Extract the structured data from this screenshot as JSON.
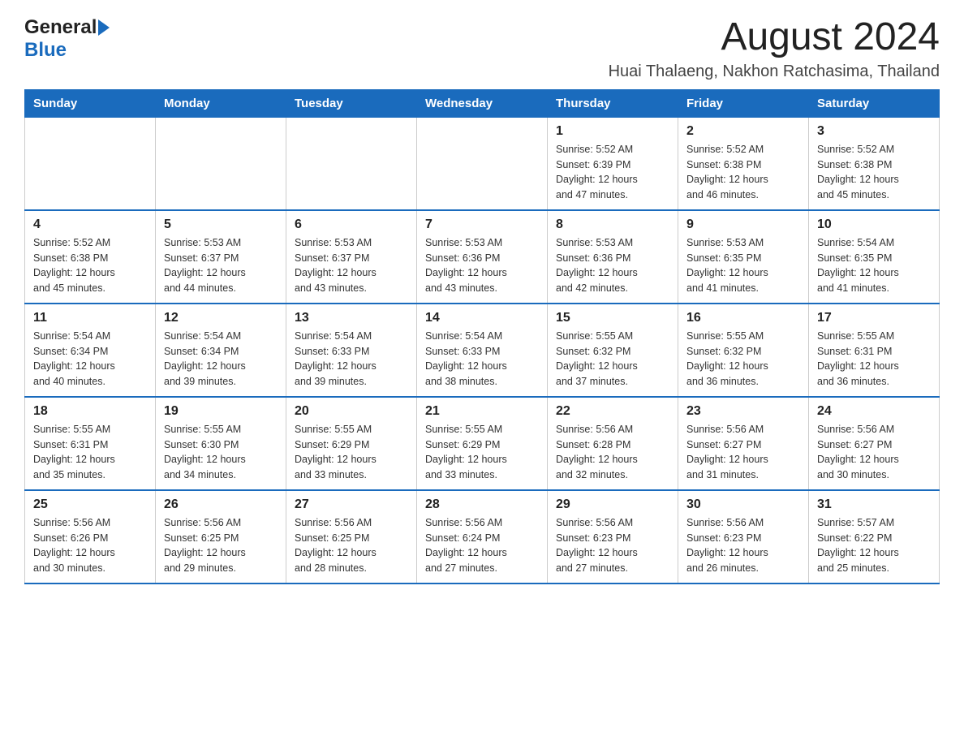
{
  "header": {
    "logo_general": "General",
    "logo_blue": "Blue",
    "month_year": "August 2024",
    "location": "Huai Thalaeng, Nakhon Ratchasima, Thailand"
  },
  "weekdays": [
    "Sunday",
    "Monday",
    "Tuesday",
    "Wednesday",
    "Thursday",
    "Friday",
    "Saturday"
  ],
  "weeks": [
    [
      {
        "day": "",
        "info": ""
      },
      {
        "day": "",
        "info": ""
      },
      {
        "day": "",
        "info": ""
      },
      {
        "day": "",
        "info": ""
      },
      {
        "day": "1",
        "info": "Sunrise: 5:52 AM\nSunset: 6:39 PM\nDaylight: 12 hours\nand 47 minutes."
      },
      {
        "day": "2",
        "info": "Sunrise: 5:52 AM\nSunset: 6:38 PM\nDaylight: 12 hours\nand 46 minutes."
      },
      {
        "day": "3",
        "info": "Sunrise: 5:52 AM\nSunset: 6:38 PM\nDaylight: 12 hours\nand 45 minutes."
      }
    ],
    [
      {
        "day": "4",
        "info": "Sunrise: 5:52 AM\nSunset: 6:38 PM\nDaylight: 12 hours\nand 45 minutes."
      },
      {
        "day": "5",
        "info": "Sunrise: 5:53 AM\nSunset: 6:37 PM\nDaylight: 12 hours\nand 44 minutes."
      },
      {
        "day": "6",
        "info": "Sunrise: 5:53 AM\nSunset: 6:37 PM\nDaylight: 12 hours\nand 43 minutes."
      },
      {
        "day": "7",
        "info": "Sunrise: 5:53 AM\nSunset: 6:36 PM\nDaylight: 12 hours\nand 43 minutes."
      },
      {
        "day": "8",
        "info": "Sunrise: 5:53 AM\nSunset: 6:36 PM\nDaylight: 12 hours\nand 42 minutes."
      },
      {
        "day": "9",
        "info": "Sunrise: 5:53 AM\nSunset: 6:35 PM\nDaylight: 12 hours\nand 41 minutes."
      },
      {
        "day": "10",
        "info": "Sunrise: 5:54 AM\nSunset: 6:35 PM\nDaylight: 12 hours\nand 41 minutes."
      }
    ],
    [
      {
        "day": "11",
        "info": "Sunrise: 5:54 AM\nSunset: 6:34 PM\nDaylight: 12 hours\nand 40 minutes."
      },
      {
        "day": "12",
        "info": "Sunrise: 5:54 AM\nSunset: 6:34 PM\nDaylight: 12 hours\nand 39 minutes."
      },
      {
        "day": "13",
        "info": "Sunrise: 5:54 AM\nSunset: 6:33 PM\nDaylight: 12 hours\nand 39 minutes."
      },
      {
        "day": "14",
        "info": "Sunrise: 5:54 AM\nSunset: 6:33 PM\nDaylight: 12 hours\nand 38 minutes."
      },
      {
        "day": "15",
        "info": "Sunrise: 5:55 AM\nSunset: 6:32 PM\nDaylight: 12 hours\nand 37 minutes."
      },
      {
        "day": "16",
        "info": "Sunrise: 5:55 AM\nSunset: 6:32 PM\nDaylight: 12 hours\nand 36 minutes."
      },
      {
        "day": "17",
        "info": "Sunrise: 5:55 AM\nSunset: 6:31 PM\nDaylight: 12 hours\nand 36 minutes."
      }
    ],
    [
      {
        "day": "18",
        "info": "Sunrise: 5:55 AM\nSunset: 6:31 PM\nDaylight: 12 hours\nand 35 minutes."
      },
      {
        "day": "19",
        "info": "Sunrise: 5:55 AM\nSunset: 6:30 PM\nDaylight: 12 hours\nand 34 minutes."
      },
      {
        "day": "20",
        "info": "Sunrise: 5:55 AM\nSunset: 6:29 PM\nDaylight: 12 hours\nand 33 minutes."
      },
      {
        "day": "21",
        "info": "Sunrise: 5:55 AM\nSunset: 6:29 PM\nDaylight: 12 hours\nand 33 minutes."
      },
      {
        "day": "22",
        "info": "Sunrise: 5:56 AM\nSunset: 6:28 PM\nDaylight: 12 hours\nand 32 minutes."
      },
      {
        "day": "23",
        "info": "Sunrise: 5:56 AM\nSunset: 6:27 PM\nDaylight: 12 hours\nand 31 minutes."
      },
      {
        "day": "24",
        "info": "Sunrise: 5:56 AM\nSunset: 6:27 PM\nDaylight: 12 hours\nand 30 minutes."
      }
    ],
    [
      {
        "day": "25",
        "info": "Sunrise: 5:56 AM\nSunset: 6:26 PM\nDaylight: 12 hours\nand 30 minutes."
      },
      {
        "day": "26",
        "info": "Sunrise: 5:56 AM\nSunset: 6:25 PM\nDaylight: 12 hours\nand 29 minutes."
      },
      {
        "day": "27",
        "info": "Sunrise: 5:56 AM\nSunset: 6:25 PM\nDaylight: 12 hours\nand 28 minutes."
      },
      {
        "day": "28",
        "info": "Sunrise: 5:56 AM\nSunset: 6:24 PM\nDaylight: 12 hours\nand 27 minutes."
      },
      {
        "day": "29",
        "info": "Sunrise: 5:56 AM\nSunset: 6:23 PM\nDaylight: 12 hours\nand 27 minutes."
      },
      {
        "day": "30",
        "info": "Sunrise: 5:56 AM\nSunset: 6:23 PM\nDaylight: 12 hours\nand 26 minutes."
      },
      {
        "day": "31",
        "info": "Sunrise: 5:57 AM\nSunset: 6:22 PM\nDaylight: 12 hours\nand 25 minutes."
      }
    ]
  ]
}
